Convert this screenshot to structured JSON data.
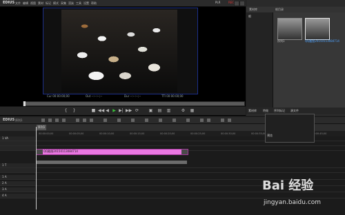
{
  "menubar": {
    "app_name": "EDIUS",
    "menus": [
      "文件",
      "编辑",
      "视图",
      "素材",
      "标记",
      "模式",
      "采集",
      "渲染",
      "工具",
      "设置",
      "帮助"
    ],
    "plr": "PLR",
    "rec": "REC"
  },
  "player": {
    "tc_in": "Cur 00:00:00;00",
    "tc_out": "Out --:--:--;--",
    "tc_dur": "Dur --:--:--;--",
    "tc_ttl": "TTl 00:00:00;00"
  },
  "bin": {
    "tabs": [
      "素材库",
      "根目录"
    ],
    "tree_root": "根",
    "clips": [
      {
        "name": "序列1",
        "selected": false
      },
      {
        "name": "QQ截图20150113084714",
        "selected": true
      }
    ],
    "bottom_tabs": [
      "素材库",
      "特效",
      "序列标记",
      "源文件"
    ]
  },
  "timeline": {
    "logo": "EDIUS",
    "sequence_name": "序列1",
    "seq_tab": "序列1",
    "ruler_ticks": [
      "00:00:00;00",
      "00:00:05;00",
      "00:00:10;00",
      "00:00:15;00",
      "00:00:20;00",
      "00:00:25;00",
      "00:00:30;00",
      "00:00:35;00",
      "00:00:40;00",
      "00:00:45;00"
    ],
    "tracks": [
      "1 VA",
      "",
      "",
      "1 T",
      "",
      "1 A",
      "2 A",
      "3 A",
      "4 A"
    ],
    "clip_label": "QQ截图20150113084714",
    "popup_label": "预览"
  },
  "watermark": {
    "logo": "Bai 经验",
    "url": "jingyan.baidu.com"
  }
}
